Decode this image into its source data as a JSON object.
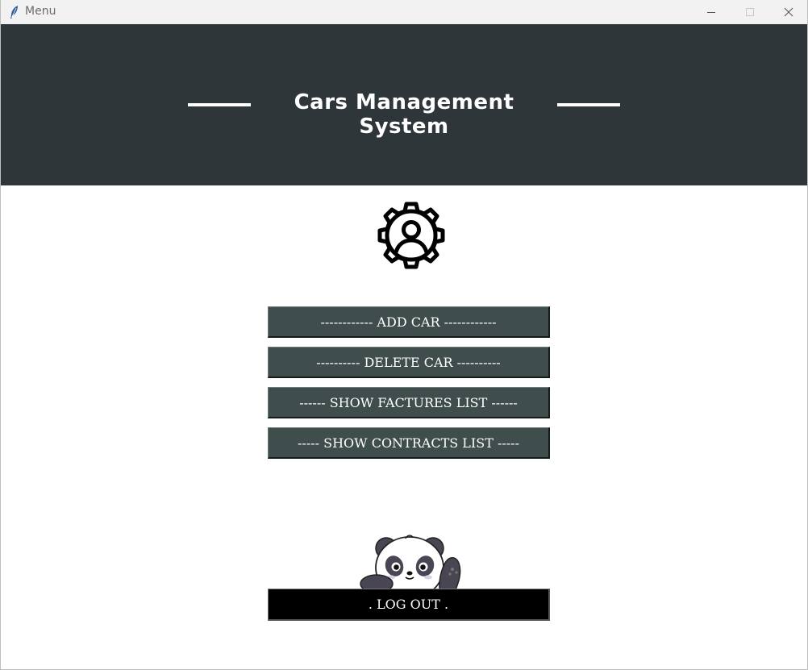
{
  "window": {
    "title": "Menu",
    "icon": "feather-icon",
    "controls": [
      "minimize-icon",
      "maximize-icon",
      "close-icon"
    ]
  },
  "header": {
    "title": "Cars Management System",
    "background": "#2e3639"
  },
  "logo": {
    "icon": "gear-user-icon"
  },
  "menu": {
    "add_car": "------------ ADD CAR ------------",
    "delete_car": "---------- DELETE CAR ----------",
    "show_factures": "------ SHOW FACTURES LIST ------",
    "show_contracts": "----- SHOW CONTRACTS LIST -----",
    "button_color": "#3f4d4c"
  },
  "footer": {
    "mascot": "panda-waving-icon",
    "logout": ". LOG OUT ."
  }
}
